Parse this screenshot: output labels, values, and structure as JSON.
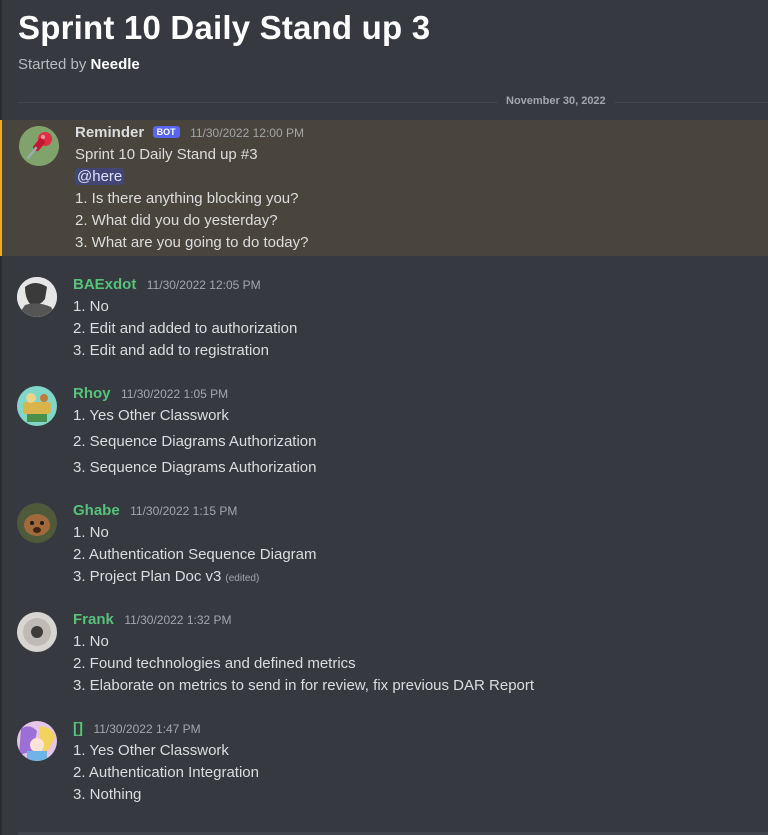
{
  "thread": {
    "title": "Sprint 10 Daily Stand up 3",
    "started_by_prefix": "Started by",
    "started_by_name": "Needle",
    "date_divider": "November 30, 2022"
  },
  "messages": [
    {
      "author": "Reminder",
      "author_color": "#dcddde",
      "bot_tag": "BOT",
      "timestamp": "11/30/2022 12:00 PM",
      "lines": [
        "Sprint 10 Daily Stand up #3",
        "@here",
        "1. Is there anything blocking you?",
        "2. What did you do yesterday?",
        "3. What are you going to do today?"
      ],
      "avatar_icon": "pushpin-icon"
    },
    {
      "author": "BAExdot",
      "author_color": "#57c27a",
      "timestamp": "11/30/2022 12:05 PM",
      "lines": [
        "1. No",
        "2. Edit and added to authorization",
        "3. Edit and add to registration"
      ]
    },
    {
      "author": "Rhoy",
      "author_color": "#57c27a",
      "timestamp": "11/30/2022 1:05 PM",
      "lines": [
        "1. Yes Other Classwork",
        "2. Sequence Diagrams Authorization",
        "3. Sequence Diagrams Authorization"
      ]
    },
    {
      "author": "Ghabe",
      "author_color": "#57c27a",
      "timestamp": "11/30/2022 1:15 PM",
      "lines": [
        "1. No",
        "2. Authentication Sequence Diagram",
        "3. Project Plan Doc v3"
      ],
      "edited_label": "(edited)"
    },
    {
      "author": "Frank",
      "author_color": "#57c27a",
      "timestamp": "11/30/2022 1:32 PM",
      "lines": [
        "1. No",
        "2. Found technologies and defined metrics",
        "3. Elaborate on metrics to send in for review, fix previous DAR Report"
      ]
    },
    {
      "author": "[]",
      "author_color": "#57c27a",
      "timestamp": "11/30/2022 1:47 PM",
      "lines": [
        "1. Yes Other Classwork",
        "2. Authentication Integration",
        "3. Nothing"
      ]
    }
  ]
}
